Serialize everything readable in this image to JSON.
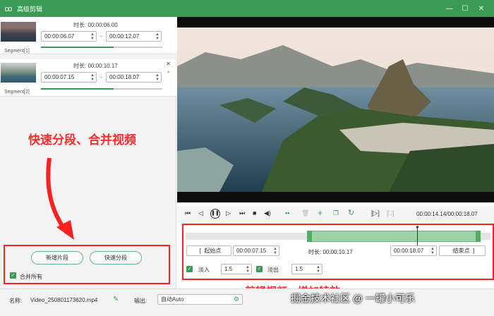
{
  "window": {
    "title": "高级剪辑",
    "min": "—",
    "max": "☐",
    "close": "✕"
  },
  "segments": [
    {
      "label": "Segment[1]",
      "duration_label": "时长:",
      "duration": "00:00:06.00",
      "start": "00:00:06.07",
      "end": "00:00:12.07"
    },
    {
      "label": "Segment[2]",
      "duration_label": "时长:",
      "duration": "00:00:10.17",
      "start": "00:00:07.15",
      "end": "00:00:18.07"
    }
  ],
  "annotations": {
    "left": "快速分段、合并视频",
    "right": "剪辑视频、增加特效"
  },
  "actions": {
    "add_segment": "新增片段",
    "quick_split": "快速分段",
    "merge_all": "合并所有"
  },
  "player": {
    "time": "00:00:14.14/00:00:18.07"
  },
  "editor": {
    "start_btn": "起始点",
    "start_time": "00:00:07.15",
    "duration_label": "时长:",
    "duration": "00:00:10.17",
    "end_time": "00:00:18.07",
    "end_btn": "结束点",
    "fade_in_label": "淡入",
    "fade_in": "1.5",
    "fade_out_label": "淡出",
    "fade_out": "1.5"
  },
  "bottom": {
    "name_label": "名称:",
    "name_value": "Video_250801173620.mp4",
    "output_label": "输出:",
    "output_value": "自动Auto",
    "watermark": "掘金技术社区 @ 一罐小可乐"
  },
  "colors": {
    "accent": "#3b9a56",
    "annotation": "#ff2c2c"
  }
}
